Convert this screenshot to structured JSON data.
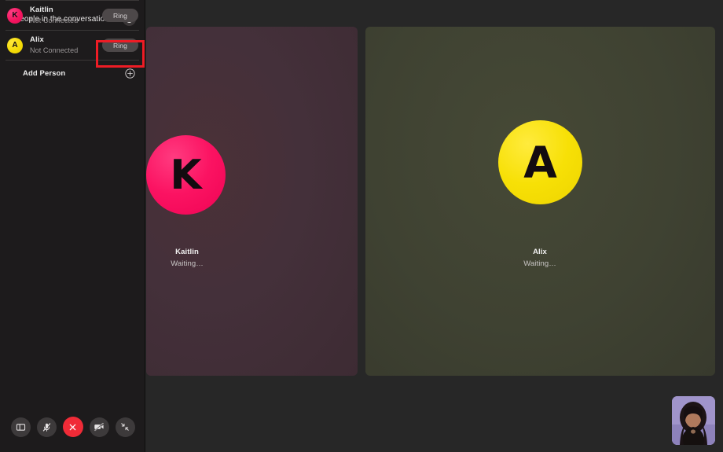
{
  "sidebar": {
    "header": {
      "title": "2 people in the conversation",
      "toggle_icon": "circle-toggle-icon"
    },
    "people": [
      {
        "initial": "K",
        "name": "Kaitlin",
        "status": "Not Connected",
        "action_label": "Ring",
        "avatar_color": "#f5155f",
        "highlighted": true
      },
      {
        "initial": "A",
        "name": "Alix",
        "status": "Not Connected",
        "action_label": "Ring",
        "avatar_color": "#f5dc08",
        "highlighted": false
      }
    ],
    "add_person": {
      "label": "Add Person",
      "icon": "plus-circle-icon"
    }
  },
  "controls": [
    {
      "name": "sidebar-toggle",
      "icon": "sidebar-panel-icon",
      "state": "off",
      "color": "#3d3a3b"
    },
    {
      "name": "microphone-toggle",
      "icon": "microphone-muted-icon",
      "state": "muted",
      "color": "#3d3a3b"
    },
    {
      "name": "end-call",
      "icon": "close-x-icon",
      "state": "active",
      "color": "#f02b37"
    },
    {
      "name": "camera-toggle",
      "icon": "video-camera-off-icon",
      "state": "off",
      "color": "#3d3a3b"
    },
    {
      "name": "shrink-view",
      "icon": "shrink-arrows-icon",
      "state": "off",
      "color": "#3d3a3b"
    }
  ],
  "stage": {
    "tiles": [
      {
        "initial": "K",
        "name": "Kaitlin",
        "status": "Waiting…",
        "bg_color": "#44303a",
        "avatar_color": "#fb1362"
      },
      {
        "initial": "A",
        "name": "Alix",
        "status": "Waiting…",
        "bg_color": "#3f4232",
        "avatar_color": "#f7e006"
      }
    ],
    "self_view": {
      "label": "self-video-thumbnail",
      "bg_color": "#9d92c8"
    }
  },
  "theme": {
    "app_bg": "#272727",
    "sidebar_bg": "#1d1b1c",
    "accent_red": "#ee1c25"
  }
}
